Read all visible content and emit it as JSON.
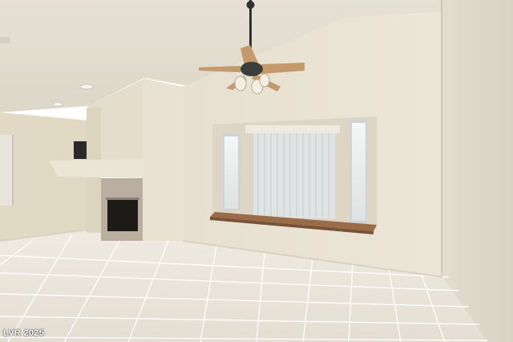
{
  "photo": {
    "watermark": "LVR 2025"
  },
  "colors": {
    "wall": "#e4dccb",
    "ceiling": "#e9e4d8",
    "tile": "#ece8dd",
    "grout": "#ffffff",
    "fan_blade": "#c49a6c",
    "fireplace_stone": "#b9aea0",
    "window_sill": "#9a6c4a"
  }
}
